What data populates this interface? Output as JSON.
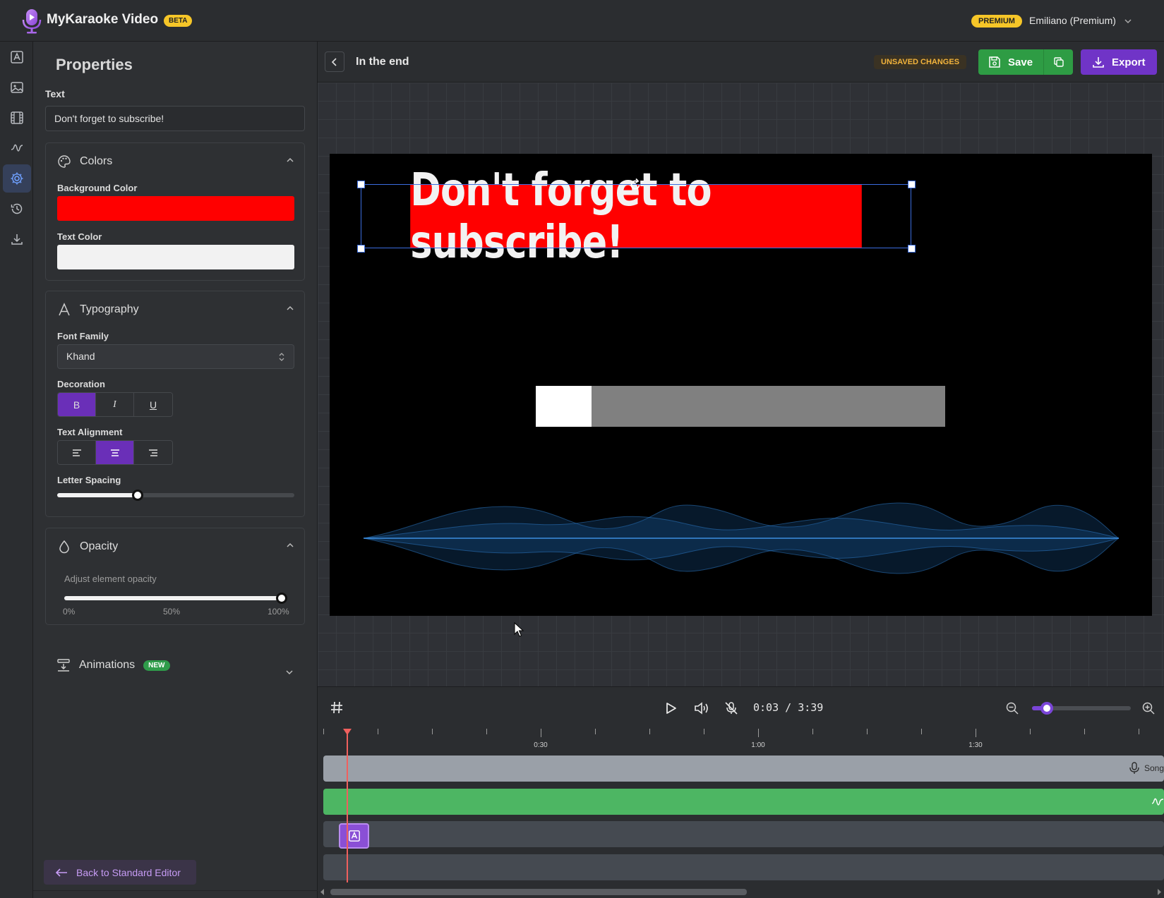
{
  "app": {
    "title": "MyKaraoke Video",
    "beta": "BETA"
  },
  "user": {
    "plan": "PREMIUM",
    "name": "Emiliano (Premium)"
  },
  "rail": [
    "text-tool-icon",
    "image-tool-icon",
    "video-tool-icon",
    "waveform-tool-icon",
    "settings-icon",
    "history-icon",
    "download-icon"
  ],
  "properties": {
    "title": "Properties",
    "text_label": "Text",
    "text_value": "Don't forget to subscribe!",
    "colors": {
      "title": "Colors",
      "bg_label": "Background Color",
      "bg_color": "#ff0000",
      "text_label": "Text Color",
      "text_color": "#f2f2f2"
    },
    "typography": {
      "title": "Typography",
      "font_label": "Font Family",
      "font_value": "Khand",
      "decoration_label": "Decoration",
      "decoration": {
        "bold": "B",
        "italic": "I",
        "underline": "U",
        "selected": "bold"
      },
      "alignment_label": "Text Alignment",
      "alignment_selected": "center",
      "letter_spacing_label": "Letter Spacing",
      "letter_spacing_fraction": 0.34
    },
    "opacity": {
      "title": "Opacity",
      "hint": "Adjust element opacity",
      "value_percent": 100,
      "min_label": "0%",
      "mid_label": "50%",
      "max_label": "100%"
    },
    "animations": {
      "title": "Animations",
      "badge": "NEW"
    },
    "back_button": "Back to Standard Editor"
  },
  "editor": {
    "project_name": "In the end",
    "unsaved": "UNSAVED CHANGES",
    "save": "Save",
    "export": "Export"
  },
  "stage": {
    "overlay_text": "Don't forget to subscribe!",
    "progress_fraction": 0.136
  },
  "transport": {
    "time": "0:03 / 3:39",
    "zoom_fraction": 0.15
  },
  "timeline": {
    "ticks": [
      "0:30",
      "1:00",
      "1:30"
    ],
    "song_label": "Song"
  }
}
